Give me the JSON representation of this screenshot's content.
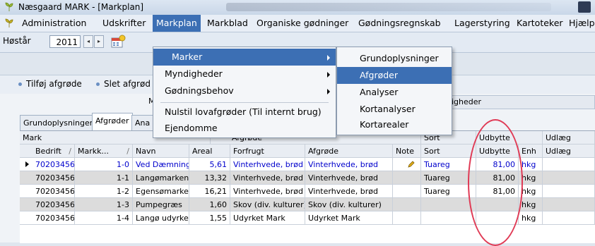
{
  "window": {
    "title": "Næsgaard MARK - [Markplan]"
  },
  "menubar": {
    "items": [
      "Administration",
      "Udskrifter",
      "Markplan",
      "Markblad",
      "Organiske gødninger",
      "Gødningsregnskab",
      "Lagerstyring",
      "Kartoteker",
      "Hjælp"
    ],
    "active": "Markplan"
  },
  "toolbar": {
    "year_label": "Høstår",
    "year_value": "2011"
  },
  "actions": {
    "add": "Tilføj afgrøde",
    "delete": "Slet afgrød"
  },
  "markplan_menu": {
    "items": [
      "Marker",
      "Myndigheder",
      "Gødningsbehov",
      "Nulstil lovafgrøder (Til internt brug)",
      "Ejendomme"
    ]
  },
  "marker_submenu": {
    "items": [
      "Grundoplysninger",
      "Afgrøder",
      "Analyser",
      "Kortanalyser",
      "Kortarealer"
    ],
    "highlighted": "Afgrøder"
  },
  "tabs": [
    "Grundoplysninger",
    "Afgrøder",
    "Ana"
  ],
  "grid": {
    "group_headers": {
      "mark": "Mark",
      "afgrode": "Afgrøde",
      "sort": "Sort",
      "udbytte": "Udbytte",
      "udlaeg": "Udlæg",
      "myndigheder": "igheder"
    },
    "columns": {
      "bedrift": "Bedrift",
      "markk": "Markk...",
      "navn": "Navn",
      "areal": "Areal",
      "forfrugt": "Forfrugt",
      "afgrode": "Afgrøde",
      "note": "Note",
      "sort": "Sort",
      "udbytte": "Udbytte",
      "enh": "Enh",
      "udlaeg": "Udlæg"
    },
    "rows": [
      {
        "bedrift": "70203456",
        "markk": "1-0",
        "navn": "Ved Dæmning",
        "areal": "5,61",
        "forfrugt": "Vinterhvede, brød",
        "afgrode": "Vinterhvede, brød",
        "sort": "Tuareg",
        "udbytte": "81,00",
        "enh": "hkg"
      },
      {
        "bedrift": "70203456",
        "markk": "1-1",
        "navn": "Langømarken",
        "areal": "13,32",
        "forfrugt": "Vinterhvede, brød",
        "afgrode": "Vinterhvede, brød",
        "sort": "Tuareg",
        "udbytte": "81,00",
        "enh": "hkg"
      },
      {
        "bedrift": "70203456",
        "markk": "1-2",
        "navn": "Egensømarke",
        "areal": "16,21",
        "forfrugt": "Vinterhvede, brød",
        "afgrode": "Vinterhvede, brød",
        "sort": "Tuareg",
        "udbytte": "81,00",
        "enh": "hkg"
      },
      {
        "bedrift": "70203456",
        "markk": "1-3",
        "navn": "Pumpegræs",
        "areal": "1,60",
        "forfrugt": "Skov (div. kulturer)",
        "afgrode": "Skov (div. kulturer)",
        "sort": "",
        "udbytte": "",
        "enh": "hkg"
      },
      {
        "bedrift": "70203456",
        "markk": "1-4",
        "navn": "Langø udyrke",
        "areal": "1,55",
        "forfrugt": "Udyrket Mark",
        "afgrode": "Udyrket Mark",
        "sort": "",
        "udbytte": "",
        "enh": "hkg"
      }
    ]
  },
  "colors": {
    "accent": "#3c6fb4",
    "annotation": "#e03a55",
    "link": "#0000cc"
  }
}
